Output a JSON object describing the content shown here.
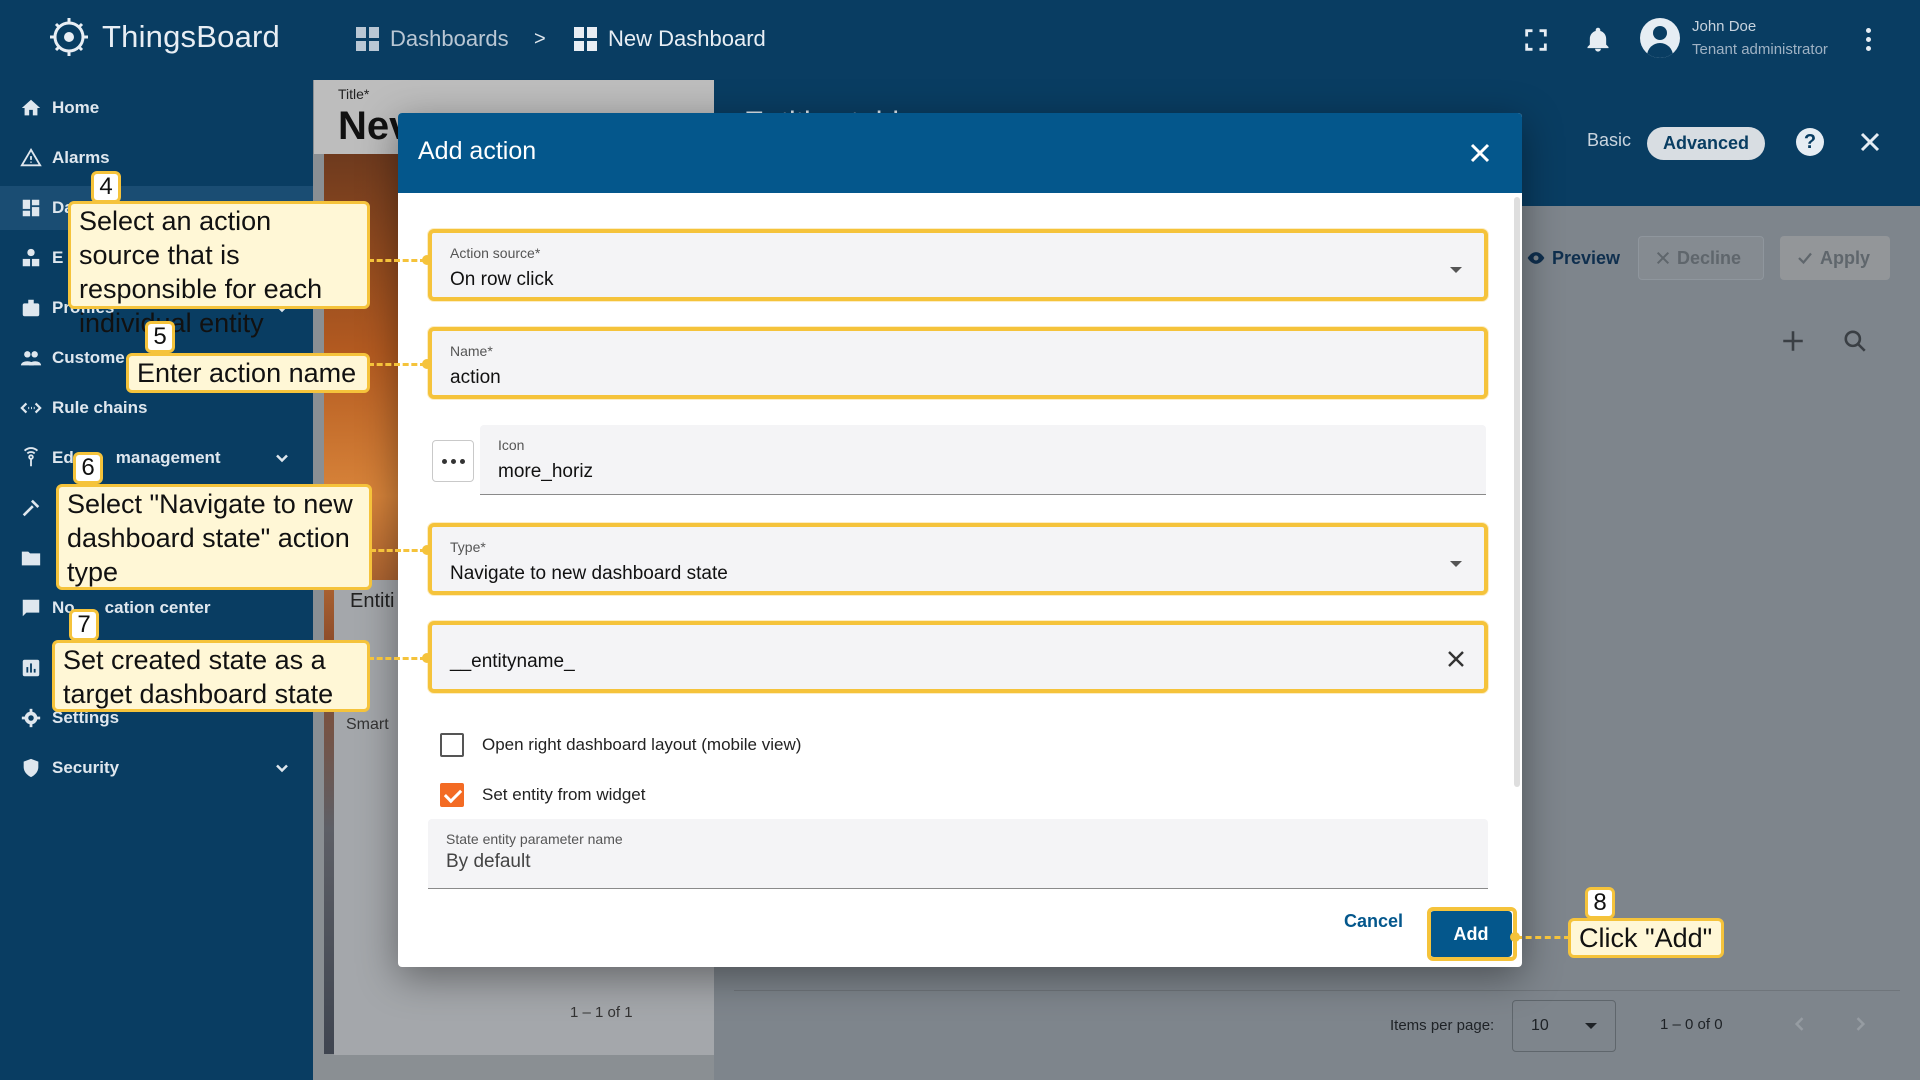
{
  "app": {
    "name": "ThingsBoard"
  },
  "breadcrumb": {
    "first": "Dashboards",
    "separator": ">",
    "current": "New Dashboard"
  },
  "user": {
    "name": "John Doe",
    "role": "Tenant administrator"
  },
  "sidebar": {
    "items": [
      {
        "label": "Home",
        "icon": "home-icon"
      },
      {
        "label": "Alarms",
        "icon": "alarm-icon"
      },
      {
        "label": "Da",
        "icon": "dashboard-icon"
      },
      {
        "label": "E",
        "icon": "entities-icon"
      },
      {
        "label": "Profiles",
        "icon": "profiles-icon"
      },
      {
        "label": "Custome",
        "icon": "customers-icon"
      },
      {
        "label": "Rule chains",
        "icon": "rule-chains-icon"
      },
      {
        "label": "Ed",
        "label2": "management",
        "icon": "edge-icon"
      },
      {
        "label": "",
        "icon": "tools-icon"
      },
      {
        "label": "",
        "icon": "folder-icon"
      },
      {
        "label": "No",
        "label2": "cation center",
        "icon": "notification-icon"
      },
      {
        "label": "",
        "icon": "chart-icon"
      },
      {
        "label": "Settings",
        "icon": "settings-icon"
      },
      {
        "label": "Security",
        "icon": "security-icon"
      }
    ]
  },
  "editor": {
    "title_label": "Title*",
    "title_value": "Nev",
    "widget_title": "Entiti",
    "row_text": "Smart",
    "pager": "1 – 1 of 1",
    "right_partial_title": "Entities table"
  },
  "mode": {
    "basic": "Basic",
    "advanced": "Advanced"
  },
  "actions": {
    "preview": "Preview",
    "decline": "Decline",
    "apply": "Apply"
  },
  "pager": {
    "items_per_page_label": "Items per page:",
    "items_per_page": "10",
    "range": "1 – 0 of 0"
  },
  "dialog": {
    "title": "Add action",
    "action_source_label": "Action source*",
    "action_source_value": "On row click",
    "name_label": "Name*",
    "name_value": "action",
    "icon_label": "Icon",
    "icon_value": "more_horiz",
    "type_label": "Type*",
    "type_value": "Navigate to new dashboard state",
    "target_state_value": "__entityname_",
    "open_right_layout_label": "Open right dashboard layout (mobile view)",
    "open_right_layout_checked": false,
    "set_entity_label": "Set entity from widget",
    "set_entity_checked": true,
    "state_param_label": "State entity parameter name",
    "state_param_value": "By default",
    "cancel": "Cancel",
    "add": "Add"
  },
  "callouts": [
    {
      "num": "4",
      "text": "Select an action source that is responsible for each individual entity"
    },
    {
      "num": "5",
      "text": "Enter action name"
    },
    {
      "num": "6",
      "text": "Select \"Navigate to new dashboard state\" action type"
    },
    {
      "num": "7",
      "text": "Set created state as a target dashboard state"
    },
    {
      "num": "8",
      "text": "Click \"Add\""
    }
  ],
  "colors": {
    "primary": "#04578c",
    "topbar": "#093d62",
    "highlight": "#f5c33b",
    "check": "#f36b24"
  }
}
